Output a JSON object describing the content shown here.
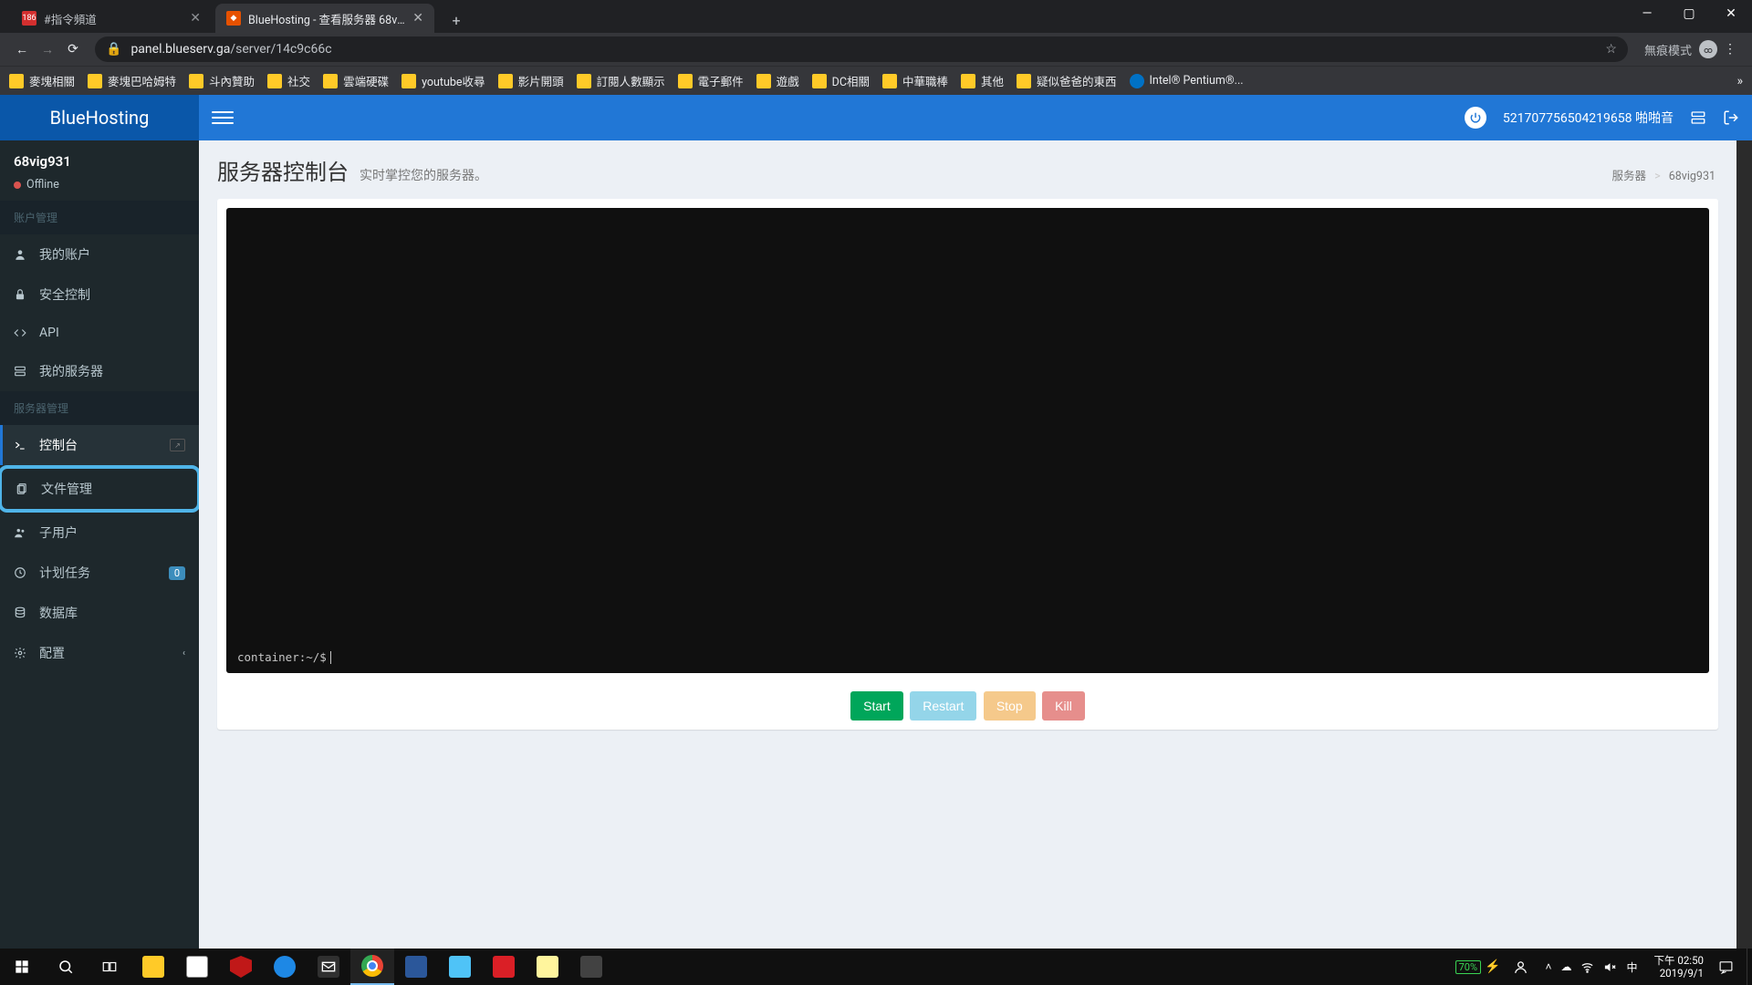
{
  "browser": {
    "tabs": [
      {
        "title": "#指令頻道",
        "favicon_bg": "#d32f2f",
        "favicon_text": "186",
        "active": false
      },
      {
        "title": "BlueHosting - 查看服务器 68vig…",
        "favicon_bg": "#ff7043",
        "favicon_text": "",
        "active": true
      }
    ],
    "window_controls": {
      "minimize": "—",
      "maximize": "▢",
      "close": "✕"
    },
    "nav": {
      "back": "←",
      "forward": "→",
      "reload": "⟳"
    },
    "url": {
      "lock": "🔒",
      "host": "panel.blueserv.ga",
      "path": "/server/14c9c66c",
      "star": "☆"
    },
    "incognito_label": "無痕模式",
    "menu": "⋮",
    "bookmarks": [
      {
        "label": "麥塊相關",
        "type": "folder"
      },
      {
        "label": "麥塊巴哈姆特",
        "type": "folder"
      },
      {
        "label": "斗內贊助",
        "type": "folder"
      },
      {
        "label": "社交",
        "type": "folder"
      },
      {
        "label": "雲端硬碟",
        "type": "folder"
      },
      {
        "label": "youtube收尋",
        "type": "folder"
      },
      {
        "label": "影片開頭",
        "type": "folder"
      },
      {
        "label": "訂閱人數顯示",
        "type": "folder"
      },
      {
        "label": "電子郵件",
        "type": "folder"
      },
      {
        "label": "遊戲",
        "type": "folder"
      },
      {
        "label": "DC相關",
        "type": "folder"
      },
      {
        "label": "中華職棒",
        "type": "folder"
      },
      {
        "label": "其他",
        "type": "folder"
      },
      {
        "label": "疑似爸爸的東西",
        "type": "folder"
      },
      {
        "label": "Intel® Pentium®...",
        "type": "link"
      }
    ],
    "bm_more": "»"
  },
  "app": {
    "logo": "BlueHosting",
    "nav_user_id": "521707756504219658 啪啪音",
    "server_name": "68vig931",
    "server_status": "Offline",
    "sections": {
      "account": "账户管理",
      "server": "服务器管理"
    },
    "menu": {
      "account": [
        {
          "icon": "user",
          "label": "我的账户"
        },
        {
          "icon": "lock",
          "label": "安全控制"
        },
        {
          "icon": "code",
          "label": "API"
        },
        {
          "icon": "servers",
          "label": "我的服务器"
        }
      ],
      "server": [
        {
          "icon": "terminal",
          "label": "控制台",
          "ext": true,
          "active": true
        },
        {
          "icon": "files",
          "label": "文件管理",
          "annot": true
        },
        {
          "icon": "users",
          "label": "子用户"
        },
        {
          "icon": "clock",
          "label": "计划任务",
          "badge": "0"
        },
        {
          "icon": "database",
          "label": "数据库"
        },
        {
          "icon": "gear",
          "label": "配置",
          "caret": true
        }
      ]
    },
    "page_title": "服务器控制台",
    "page_subtitle": "实时掌控您的服务器。",
    "breadcrumb": {
      "root": "服务器",
      "current": "68vig931",
      "sep": ">"
    },
    "terminal_prompt": "container:~/$",
    "buttons": {
      "start": "Start",
      "restart": "Restart",
      "stop": "Stop",
      "kill": "Kill"
    }
  },
  "taskbar": {
    "battery_pct": "70%",
    "ime": "中",
    "time": "下午 02:50",
    "date": "2019/9/1",
    "apps": [
      {
        "name": "file-explorer",
        "color": "#ffca28"
      },
      {
        "name": "ms-store",
        "color": "#ffffff"
      },
      {
        "name": "mcafee",
        "color": "#c01818"
      },
      {
        "name": "blue-app",
        "color": "#1e88e5"
      },
      {
        "name": "mail",
        "color": "#efefef"
      },
      {
        "name": "chrome",
        "color": "#ffffff",
        "active": true
      },
      {
        "name": "word",
        "color": "#2b579a"
      },
      {
        "name": "laptop",
        "color": "#4fc3f7"
      },
      {
        "name": "adobe",
        "color": "#da1f26"
      },
      {
        "name": "notes",
        "color": "#fff59d"
      },
      {
        "name": "photos",
        "color": "#424242"
      }
    ]
  }
}
